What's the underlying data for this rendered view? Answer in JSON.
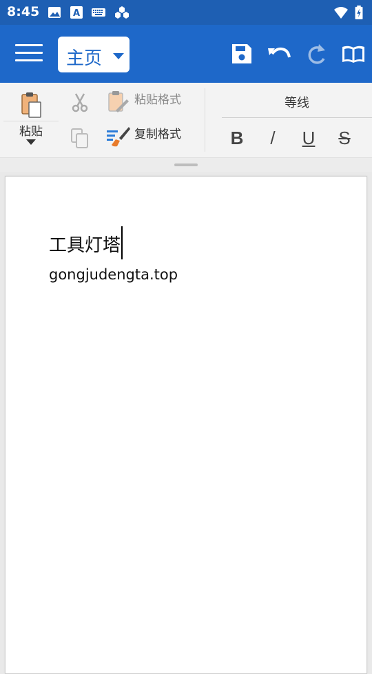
{
  "status_bar": {
    "time": "8:45",
    "icons": [
      "image-icon",
      "text-a-icon",
      "keyboard-icon",
      "app-hex-icon",
      "wifi-icon",
      "battery-icon"
    ]
  },
  "app_bar": {
    "tab_label": "主页",
    "actions": [
      "save-icon",
      "undo-icon",
      "redo-icon",
      "read-mode-icon"
    ],
    "color": "#1e68c9"
  },
  "ribbon": {
    "paste_label": "粘贴",
    "paste_format_label": "粘贴格式",
    "copy_format_label": "复制格式",
    "font_name": "等线",
    "bold": "B",
    "italic": "/",
    "underline": "U",
    "strikethrough": "S"
  },
  "document": {
    "line1": "工具灯塔",
    "line2": "gongjudengta.top"
  }
}
